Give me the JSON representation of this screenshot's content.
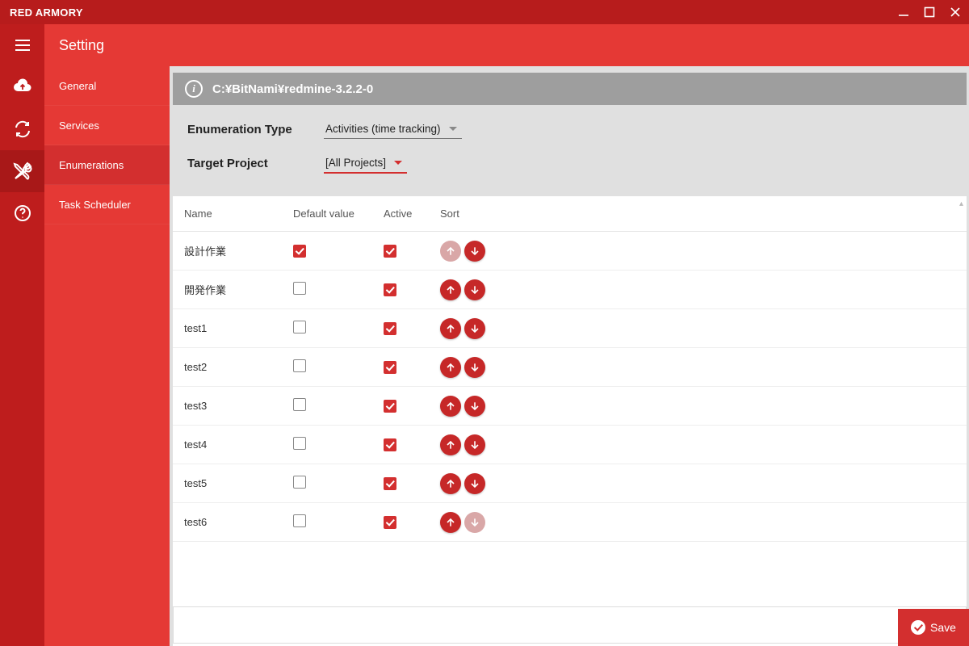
{
  "app": {
    "title": "RED ARMORY"
  },
  "header": {
    "title": "Setting"
  },
  "sidebar": {
    "items": [
      {
        "label": "General"
      },
      {
        "label": "Services"
      },
      {
        "label": "Enumerations"
      },
      {
        "label": "Task Scheduler"
      }
    ],
    "active_index": 2
  },
  "path": "C:¥BitNami¥redmine-3.2.2-0",
  "filters": {
    "enum_type_label": "Enumeration Type",
    "enum_type_value": "Activities (time tracking)",
    "target_project_label": "Target Project",
    "target_project_value": "[All Projects]"
  },
  "columns": {
    "name": "Name",
    "default": "Default value",
    "active": "Active",
    "sort": "Sort"
  },
  "rows": [
    {
      "name": "設計作業",
      "default": true,
      "active": true,
      "can_up": false,
      "can_down": true
    },
    {
      "name": "開発作業",
      "default": false,
      "active": true,
      "can_up": true,
      "can_down": true
    },
    {
      "name": "test1",
      "default": false,
      "active": true,
      "can_up": true,
      "can_down": true
    },
    {
      "name": "test2",
      "default": false,
      "active": true,
      "can_up": true,
      "can_down": true
    },
    {
      "name": "test3",
      "default": false,
      "active": true,
      "can_up": true,
      "can_down": true
    },
    {
      "name": "test4",
      "default": false,
      "active": true,
      "can_up": true,
      "can_down": true
    },
    {
      "name": "test5",
      "default": false,
      "active": true,
      "can_up": true,
      "can_down": true
    },
    {
      "name": "test6",
      "default": false,
      "active": true,
      "can_up": true,
      "can_down": false
    }
  ],
  "save_label": "Save"
}
